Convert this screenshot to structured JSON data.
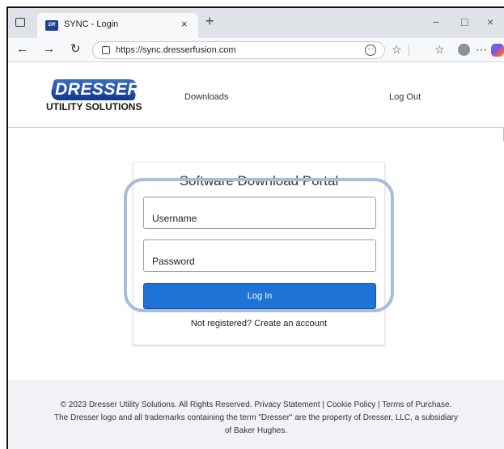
{
  "browser": {
    "tab_title": "SYNC - Login",
    "tab_close": "×",
    "new_tab": "+",
    "window_controls": [
      "−",
      "□",
      "×"
    ],
    "url": "https://sync.dresserfusion.com",
    "favicon_text": "DR"
  },
  "header": {
    "logo_main": "DRESSER",
    "logo_sub": "UTILITY SOLUTIONS",
    "nav_downloads": "Downloads",
    "nav_logout": "Log Out"
  },
  "login": {
    "title": "Software Download Portal",
    "username_label": "Username",
    "password_label": "Password",
    "login_button": "Log In",
    "register_link": "Not registered? Create an account"
  },
  "footer": {
    "line1": "© 2023 Dresser Utility Solutions. All Rights Reserved. Privacy Statement | Cookie Policy | Terms of Purchase.",
    "line2": "The Dresser logo and all trademarks containing the term \"Dresser\" are the property of Dresser, LLC, a subsidiary",
    "line3": "of Baker Hughes."
  },
  "colors": {
    "brand_blue": "#0f3a8a",
    "button_blue": "#1f73d6",
    "highlight": "#a8bcdc"
  }
}
